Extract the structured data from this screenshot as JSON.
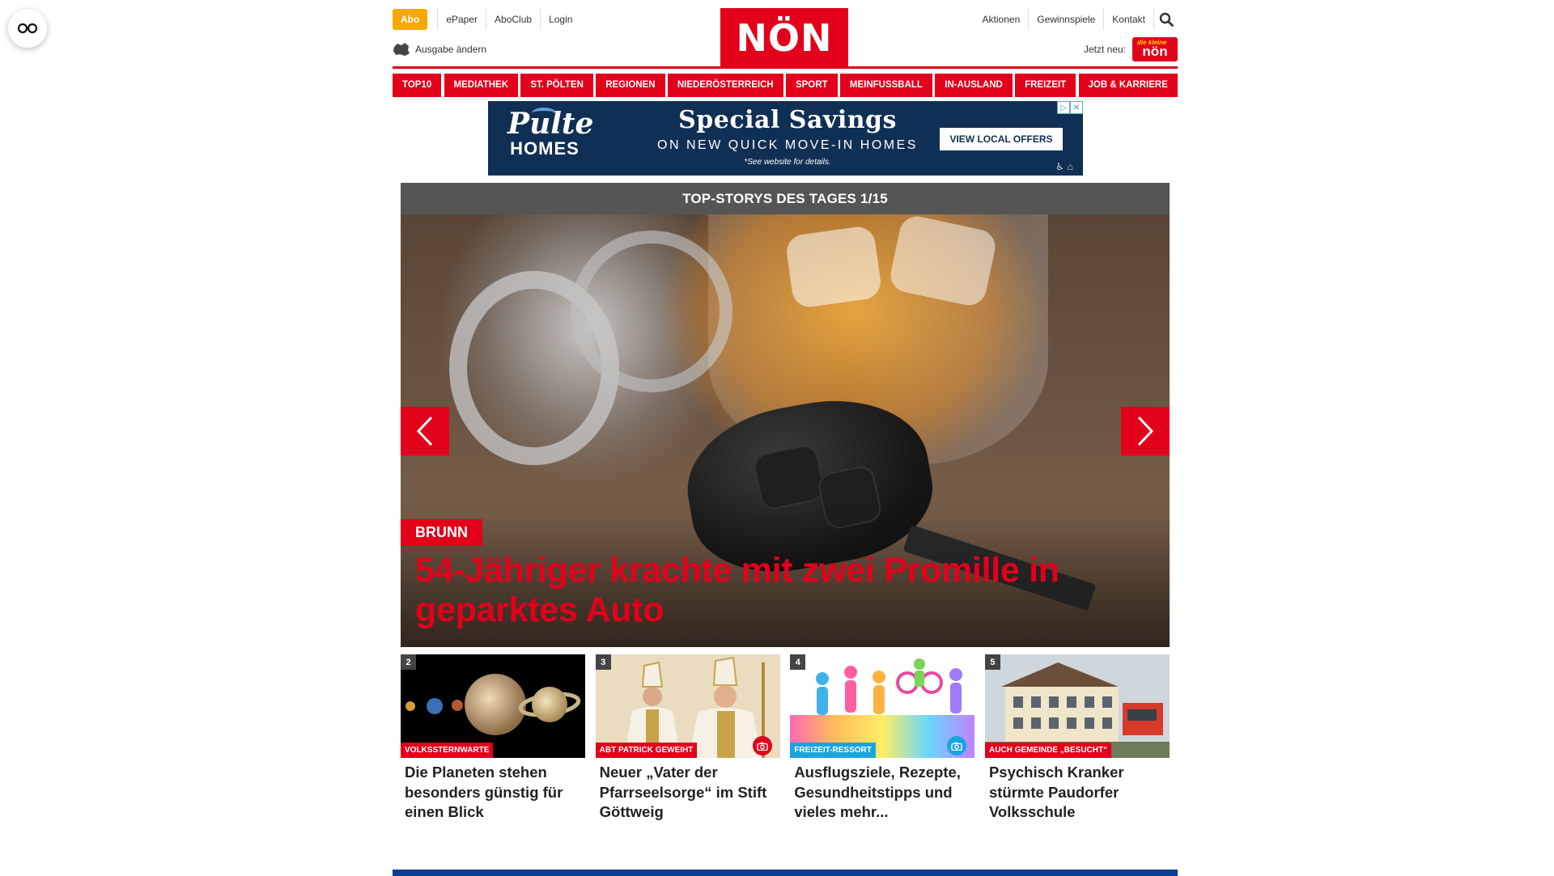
{
  "header": {
    "abo": "Abo",
    "left_links": [
      "ePaper",
      "AboClub",
      "Login"
    ],
    "ausgabe": "Ausgabe ändern",
    "logo": "NÖN",
    "right_links": [
      "Aktionen",
      "Gewinnspiele",
      "Kontakt"
    ],
    "jetzt_neu": "Jetzt neu:",
    "badge_text": "nön",
    "badge_small": "die kleine"
  },
  "nav": [
    "TOP10",
    "MEDIATHEK",
    "ST. PÖLTEN",
    "REGIONEN",
    "NIEDERÖSTERREICH",
    "SPORT",
    "MEINFUSSBALL",
    "IN-AUSLAND",
    "FREIZEIT",
    "JOB & KARRIERE"
  ],
  "ad": {
    "brand_top": "Pulte",
    "brand_bottom": "HOMES",
    "headline": "Special Savings",
    "sub": "ON NEW QUICK MOVE-IN HOMES",
    "note": "*See website for details.",
    "cta": "VIEW LOCAL OFFERS"
  },
  "stories": {
    "bar_title": "TOP-STORYS DES TAGES 1/15",
    "hero_tag": "BRUNN",
    "hero_title": "54-Jähriger krachte mit zwei Promille in geparktes Auto"
  },
  "cards": [
    {
      "num": "2",
      "tag": "VOLKSSTERNWARTE",
      "tag_color": "red",
      "has_camera": false,
      "title": "Die Planeten stehen besonders günstig für einen Blick"
    },
    {
      "num": "3",
      "tag": "ABT PATRICK GEWEIHT",
      "tag_color": "red",
      "has_camera": true,
      "title": "Neuer „Vater der Pfarrseelsorge“ im Stift Göttweig"
    },
    {
      "num": "4",
      "tag": "FREIZEIT-RESSORT",
      "tag_color": "blue",
      "has_camera": true,
      "title": "Ausflugsziele, Rezepte, Gesundheitstipps und vieles mehr..."
    },
    {
      "num": "5",
      "tag": "AUCH GEMEINDE „BESUCHT“",
      "tag_color": "red",
      "has_camera": false,
      "title": "Psychisch Kranker stürmte Paudorfer Volksschule"
    }
  ],
  "colors": {
    "brand_red": "#e2001a",
    "abo_orange": "#f5a800",
    "freizeit_blue": "#1aa4df",
    "ad_navy": "#102f54"
  }
}
